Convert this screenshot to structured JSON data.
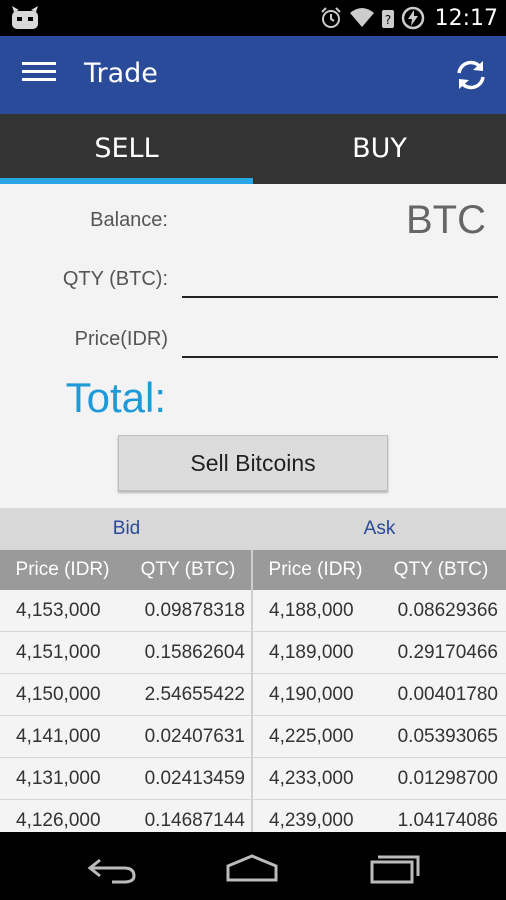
{
  "status_bar": {
    "time": "12:17",
    "icons": [
      "cyanogen-icon",
      "alarm-icon",
      "wifi-icon",
      "no-signal-icon",
      "battery-charging-icon"
    ]
  },
  "action_bar": {
    "title": "Trade",
    "menu_icon": "hamburger-menu-icon",
    "refresh_icon": "refresh-icon"
  },
  "tabs": [
    {
      "label": "SELL",
      "active": true
    },
    {
      "label": "BUY",
      "active": false
    }
  ],
  "form": {
    "balance_label": "Balance:",
    "balance_unit": "BTC",
    "qty_label": "QTY (BTC):",
    "qty_value": "",
    "price_label": "Price(IDR)",
    "price_value": "",
    "total_label": "Total:",
    "submit_label": "Sell Bitcoins"
  },
  "order_book": {
    "bid_title": "Bid",
    "ask_title": "Ask",
    "columns": [
      "Price (IDR)",
      "QTY (BTC)",
      "Price (IDR)",
      "QTY (BTC)"
    ],
    "rows": [
      {
        "bid_price": "4,153,000",
        "bid_qty": "0.09878318",
        "ask_price": "4,188,000",
        "ask_qty": "0.08629366"
      },
      {
        "bid_price": "4,151,000",
        "bid_qty": "0.15862604",
        "ask_price": "4,189,000",
        "ask_qty": "0.29170466"
      },
      {
        "bid_price": "4,150,000",
        "bid_qty": "2.54655422",
        "ask_price": "4,190,000",
        "ask_qty": "0.00401780"
      },
      {
        "bid_price": "4,141,000",
        "bid_qty": "0.02407631",
        "ask_price": "4,225,000",
        "ask_qty": "0.05393065"
      },
      {
        "bid_price": "4,131,000",
        "bid_qty": "0.02413459",
        "ask_price": "4,233,000",
        "ask_qty": "0.01298700"
      },
      {
        "bid_price": "4,126,000",
        "bid_qty": "0.14687144",
        "ask_price": "4,239,000",
        "ask_qty": "1.04174086"
      }
    ]
  },
  "nav_bar": {
    "buttons": [
      "back-icon",
      "home-icon",
      "recent-apps-icon"
    ]
  },
  "colors": {
    "action_bar": "#2a4a9a",
    "tab_bar": "#333333",
    "tab_indicator": "#29a6e6",
    "total_accent": "#1e9ad8",
    "header_blue": "#2a4a9a"
  }
}
